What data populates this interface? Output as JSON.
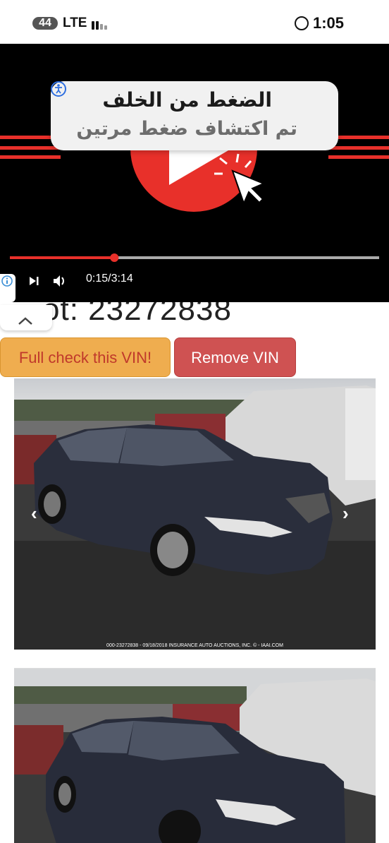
{
  "status_bar": {
    "signal_badge": "44",
    "network": "LTE",
    "time": "1:05"
  },
  "accessibility_toast": {
    "title": "الضغط من الخلف",
    "subtitle": "تم اكتشاف ضغط مرتين"
  },
  "video_player": {
    "time_display": "0:15/3:14",
    "progress_fraction": 0.283
  },
  "heading": {
    "partial_text": "ot: 23272838"
  },
  "buttons": {
    "full_check": "Full check this VIN!",
    "remove_vin": "Remove VIN"
  },
  "photos": [
    {
      "watermark": "000-23272838 - 09/18/2018 INSURANCE AUTO AUCTIONS, INC. © - IAAI.COM"
    },
    {
      "watermark": ""
    }
  ],
  "colors": {
    "youtube_red": "#e8302a",
    "full_check_bg": "#efad4f",
    "remove_bg": "#cf5252"
  }
}
